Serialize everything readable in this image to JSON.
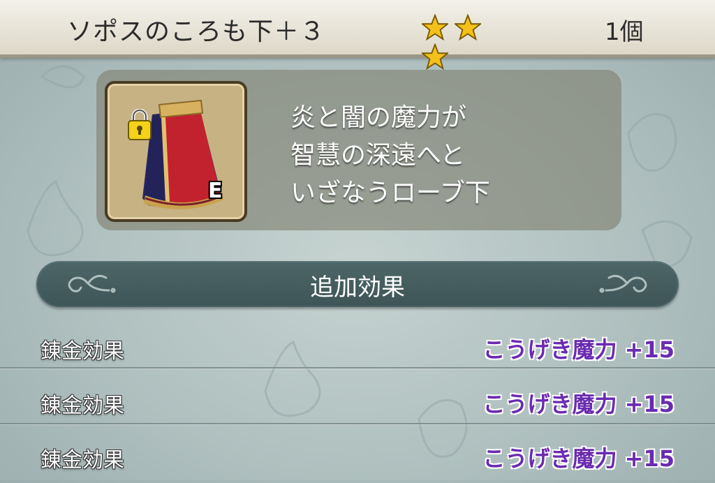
{
  "header": {
    "item_name": "ソポスのころも下＋３",
    "rarity_stars": 3,
    "count": "1個"
  },
  "item": {
    "grade": "E",
    "description_lines": [
      "炎と闇の魔力が",
      "智慧の深遠へと",
      "いざなうローブ下"
    ]
  },
  "section": {
    "title": "追加効果"
  },
  "effects": [
    {
      "label": "錬金効果",
      "value": "こうげき魔力 +15"
    },
    {
      "label": "錬金効果",
      "value": "こうげき魔力 +15"
    },
    {
      "label": "錬金効果",
      "value": "こうげき魔力 +15"
    }
  ],
  "colors": {
    "star": "#f2c21a",
    "effect_value": "#6a2bb0",
    "banner": "#46605f"
  }
}
